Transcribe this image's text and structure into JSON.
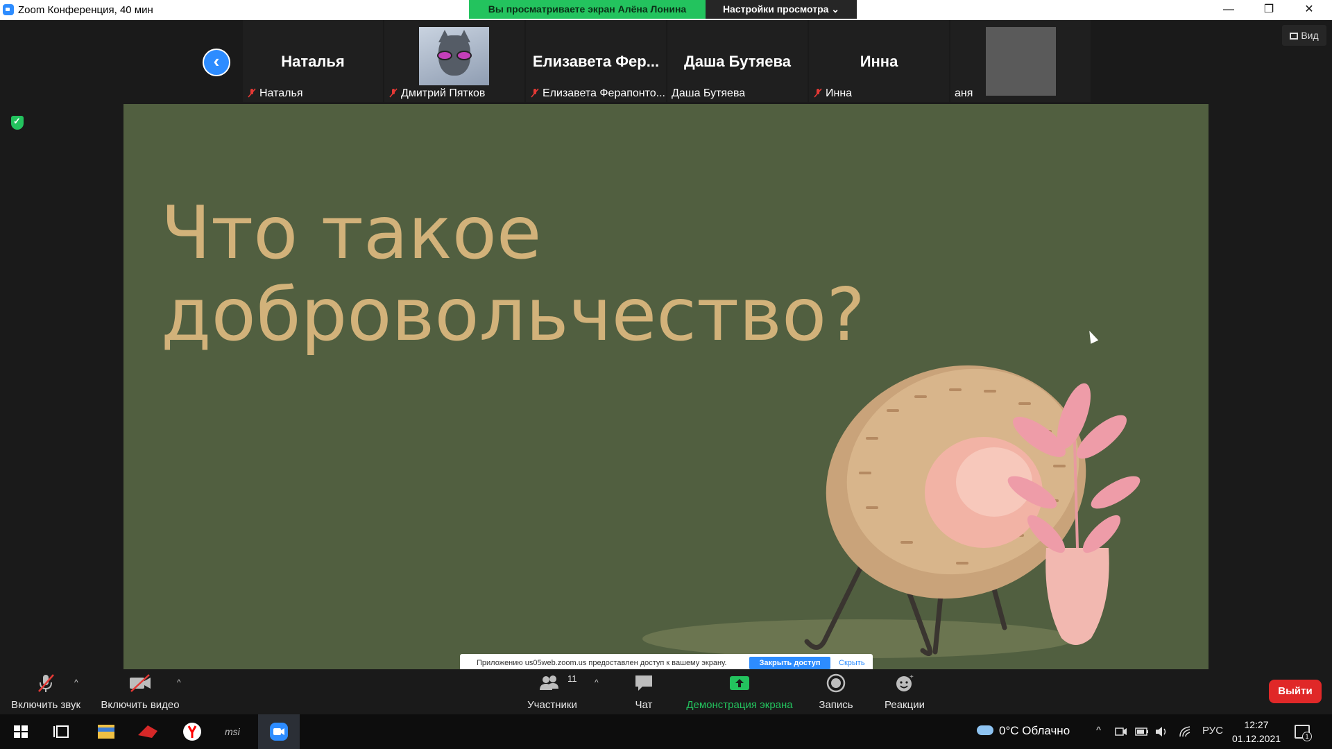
{
  "window": {
    "title": "Zoom Конференция, 40 мин",
    "controls": [
      "—",
      "❐",
      "✕"
    ]
  },
  "share_banner": {
    "text": "Вы просматриваете экран Алёна Лонина",
    "view_options": "Настройки просмотра ⌄"
  },
  "view_button": "Вид",
  "participants": [
    {
      "display": "Наталья",
      "label": "Наталья",
      "muted": true,
      "video": false
    },
    {
      "display": "",
      "label": "Дмитрий Пятков",
      "muted": true,
      "video": true,
      "avatar": "cat-with-sunglasses"
    },
    {
      "display": "Елизавета Фер...",
      "label": "Елизавета Ферапонто...",
      "muted": true,
      "video": false
    },
    {
      "display": "Даша Бутяева",
      "label": "Даша Бутяева",
      "muted": false,
      "video": false
    },
    {
      "display": "Инна",
      "label": "Инна",
      "muted": true,
      "video": false
    },
    {
      "display": "",
      "label": "аня",
      "muted": false,
      "video": true
    }
  ],
  "slide": {
    "title_line1": "Что такое",
    "title_line2": "добровольчество?",
    "background": "#515f40",
    "title_color": "#d2b27a"
  },
  "toast": {
    "message": "Приложению us05web.zoom.us предоставлен доступ к вашему экрану.",
    "stop_label": "Закрыть доступ",
    "hide_label": "Скрыть"
  },
  "toolbar": {
    "audio": "Включить звук",
    "video": "Включить видео",
    "participants": "Участники",
    "participants_count": "11",
    "chat": "Чат",
    "share": "Демонстрация экрана",
    "record": "Запись",
    "reactions": "Реакции",
    "leave": "Выйти",
    "share_color": "#23c35e",
    "leave_color": "#e02828"
  },
  "taskbar": {
    "weather": "0°C  Облачно",
    "language": "РУС",
    "time": "12:27",
    "date": "01.12.2021",
    "notifications": "1"
  }
}
